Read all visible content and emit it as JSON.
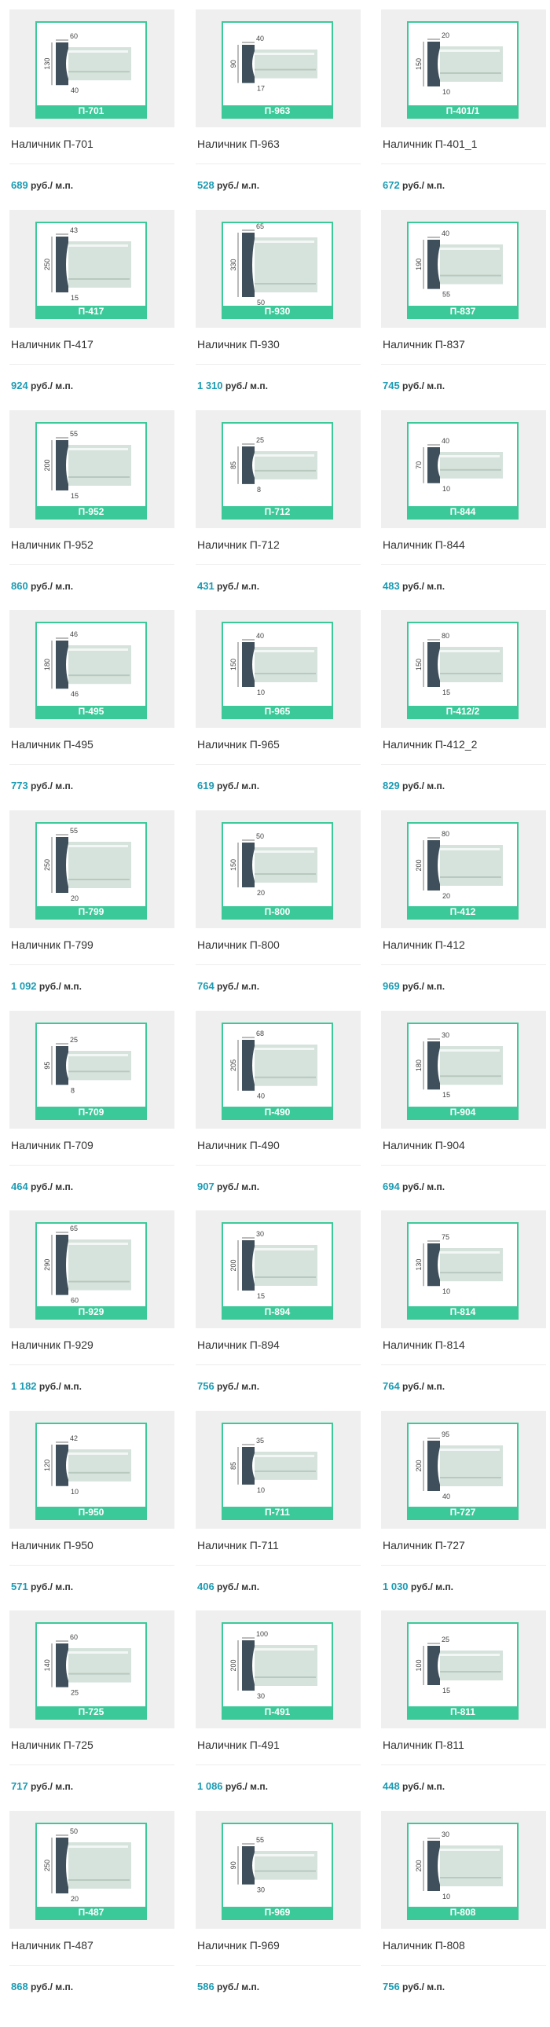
{
  "unit": "руб./ м.п.",
  "products": [
    {
      "code": "П-701",
      "title": "Наличник П-701",
      "price": "689",
      "dims": {
        "h": "130",
        "w": "60",
        "b": "40"
      }
    },
    {
      "code": "П-963",
      "title": "Наличник П-963",
      "price": "528",
      "dims": {
        "h": "90",
        "w": "40",
        "b": "17"
      }
    },
    {
      "code": "П-401/1",
      "title": "Наличник П-401_1",
      "price": "672",
      "dims": {
        "h": "150",
        "w": "20",
        "b": "10"
      }
    },
    {
      "code": "П-417",
      "title": "Наличник П-417",
      "price": "924",
      "dims": {
        "h": "250",
        "w": "43",
        "b": "15"
      }
    },
    {
      "code": "П-930",
      "title": "Наличник П-930",
      "price": "1 310",
      "dims": {
        "h": "330",
        "w": "65",
        "b": "50"
      }
    },
    {
      "code": "П-837",
      "title": "Наличник П-837",
      "price": "745",
      "dims": {
        "h": "190",
        "w": "40",
        "b": "55"
      }
    },
    {
      "code": "П-952",
      "title": "Наличник П-952",
      "price": "860",
      "dims": {
        "h": "200",
        "w": "55",
        "b": "15"
      }
    },
    {
      "code": "П-712",
      "title": "Наличник П-712",
      "price": "431",
      "dims": {
        "h": "85",
        "w": "25",
        "b": "8"
      }
    },
    {
      "code": "П-844",
      "title": "Наличник П-844",
      "price": "483",
      "dims": {
        "h": "70",
        "w": "40",
        "b": "10"
      }
    },
    {
      "code": "П-495",
      "title": "Наличник П-495",
      "price": "773",
      "dims": {
        "h": "180",
        "w": "46",
        "b": "46"
      }
    },
    {
      "code": "П-965",
      "title": "Наличник П-965",
      "price": "619",
      "dims": {
        "h": "150",
        "w": "40",
        "b": "10"
      }
    },
    {
      "code": "П-412/2",
      "title": "Наличник П-412_2",
      "price": "829",
      "dims": {
        "h": "150",
        "w": "80",
        "b": "15"
      }
    },
    {
      "code": "П-799",
      "title": "Наличник П-799",
      "price": "1 092",
      "dims": {
        "h": "250",
        "w": "55",
        "b": "20"
      }
    },
    {
      "code": "П-800",
      "title": "Наличник П-800",
      "price": "764",
      "dims": {
        "h": "150",
        "w": "50",
        "b": "20"
      }
    },
    {
      "code": "П-412",
      "title": "Наличник П-412",
      "price": "969",
      "dims": {
        "h": "200",
        "w": "80",
        "b": "20"
      }
    },
    {
      "code": "П-709",
      "title": "Наличник П-709",
      "price": "464",
      "dims": {
        "h": "95",
        "w": "25",
        "b": "8"
      }
    },
    {
      "code": "П-490",
      "title": "Наличник П-490",
      "price": "907",
      "dims": {
        "h": "205",
        "w": "68",
        "b": "40"
      }
    },
    {
      "code": "П-904",
      "title": "Наличник П-904",
      "price": "694",
      "dims": {
        "h": "180",
        "w": "30",
        "b": "15"
      }
    },
    {
      "code": "П-929",
      "title": "Наличник П-929",
      "price": "1 182",
      "dims": {
        "h": "290",
        "w": "65",
        "b": "60"
      }
    },
    {
      "code": "П-894",
      "title": "Наличник П-894",
      "price": "756",
      "dims": {
        "h": "200",
        "w": "30",
        "b": "15"
      }
    },
    {
      "code": "П-814",
      "title": "Наличник П-814",
      "price": "764",
      "dims": {
        "h": "130",
        "w": "75",
        "b": "10"
      }
    },
    {
      "code": "П-950",
      "title": "Наличник П-950",
      "price": "571",
      "dims": {
        "h": "120",
        "w": "42",
        "b": "10"
      }
    },
    {
      "code": "П-711",
      "title": "Наличник П-711",
      "price": "406",
      "dims": {
        "h": "85",
        "w": "35",
        "b": "10"
      }
    },
    {
      "code": "П-727",
      "title": "Наличник П-727",
      "price": "1 030",
      "dims": {
        "h": "200",
        "w": "95",
        "b": "40"
      }
    },
    {
      "code": "П-725",
      "title": "Наличник П-725",
      "price": "717",
      "dims": {
        "h": "140",
        "w": "60",
        "b": "25"
      }
    },
    {
      "code": "П-491",
      "title": "Наличник П-491",
      "price": "1 086",
      "dims": {
        "h": "200",
        "w": "100",
        "b": "30"
      }
    },
    {
      "code": "П-811",
      "title": "Наличник П-811",
      "price": "448",
      "dims": {
        "h": "100",
        "w": "25",
        "b": "15"
      }
    },
    {
      "code": "П-487",
      "title": "Наличник П-487",
      "price": "868",
      "dims": {
        "h": "250",
        "w": "50",
        "b": "20"
      }
    },
    {
      "code": "П-969",
      "title": "Наличник П-969",
      "price": "586",
      "dims": {
        "h": "90",
        "w": "55",
        "b": "30"
      }
    },
    {
      "code": "П-808",
      "title": "Наличник П-808",
      "price": "756",
      "dims": {
        "h": "200",
        "w": "30",
        "b": "10"
      }
    }
  ],
  "colors": {
    "accent": "#3cc99a",
    "price": "#1b9bb3",
    "profile": "#3f4f5b",
    "molding": "#d6e3dc"
  }
}
